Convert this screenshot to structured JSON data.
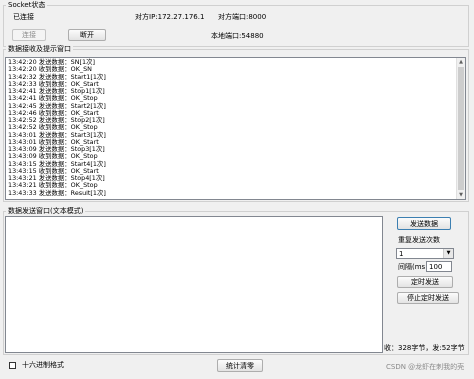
{
  "socket_group": {
    "title": "Socket状态",
    "status_label": "已连接",
    "remote_ip_label": "对方IP:172.27.176.1",
    "remote_port_label": "对方端口:8000",
    "local_port_label": "本地端口:54880",
    "connect_button": "连接",
    "disconnect_button": "断开"
  },
  "receive_group": {
    "title": "数据接收及提示窗口",
    "lines": [
      "13:42:20 发送数据：SN[1次]",
      "13:42:20 收到数据：OK_SN",
      "13:42:32 发送数据：Start1[1次]",
      "13:42:33 收到数据：OK_Start",
      "13:42:41 发送数据：Stop1[1次]",
      "13:42:41 收到数据：OK_Stop",
      "13:42:45 发送数据：Start2[1次]",
      "13:42:46 收到数据：OK_Start",
      "13:42:52 发送数据：Stop2[1次]",
      "13:42:52 收到数据：OK_Stop",
      "13:43:01 发送数据：Start3[1次]",
      "13:43:01 收到数据：OK_Start",
      "13:43:09 发送数据：Stop3[1次]",
      "13:43:09 收到数据：OK_Stop",
      "13:43:15 发送数据：Start4[1次]",
      "13:43:15 收到数据：OK_Start",
      "13:43:21 发送数据：Stop4[1次]",
      "13:43:21 收到数据：OK_Stop",
      "13:43:33 发送数据：Result[1次]"
    ]
  },
  "send_group": {
    "title": "数据发送窗口(文本模式)",
    "input_value": "",
    "send_button": "发送数据",
    "repeat_label": "重复发送次数",
    "repeat_value": "1",
    "interval_label": "间隔(ms",
    "interval_value": "100",
    "timed_send_button": "定时发送",
    "stop_timed_button": "停止定时发送",
    "stats": "收：328字节，发:52字节"
  },
  "bottom": {
    "hex_label": "十六进制格式",
    "clear_button": "统计清零",
    "watermark": "CSDN @龙虾在刺我的壳"
  }
}
